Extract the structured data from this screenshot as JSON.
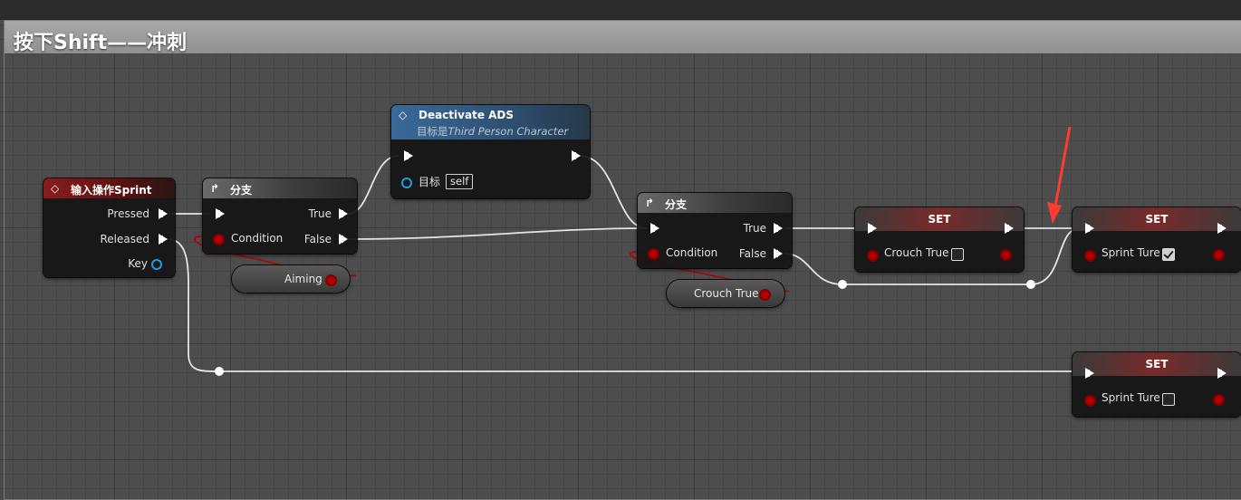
{
  "comment": {
    "title": "按下Shift——冲刺"
  },
  "nodes": {
    "input_action": {
      "title": "输入操作Sprint",
      "pins": {
        "pressed": "Pressed",
        "released": "Released",
        "key": "Key"
      }
    },
    "branch1": {
      "title": "分支",
      "pins": {
        "condition": "Condition",
        "true": "True",
        "false": "False"
      }
    },
    "aiming_var": {
      "label": "Aiming"
    },
    "deactivate_ads": {
      "title": "Deactivate ADS",
      "subtitle_prefix": "目标是",
      "subtitle_target": "Third Person Character",
      "pins": {
        "target": "目标",
        "target_value": "self"
      }
    },
    "branch2": {
      "title": "分支",
      "pins": {
        "condition": "Condition",
        "true": "True",
        "false": "False"
      }
    },
    "crouch_var": {
      "label": "Crouch True"
    },
    "set_crouch": {
      "title": "SET",
      "pin": "Crouch True",
      "checked": false
    },
    "set_sprint_true": {
      "title": "SET",
      "pin": "Sprint Ture",
      "checked": true
    },
    "set_sprint_false": {
      "title": "SET",
      "pin": "Sprint Ture",
      "checked": false
    }
  },
  "icons": {
    "event": "diamond-event-icon",
    "branch": "branch-icon",
    "function": "function-icon"
  },
  "colors": {
    "event_header": "#8a1c1c",
    "function_header": "#3a6a9a",
    "bool_pin": "#b00000",
    "key_pin": "#1e9be8",
    "annotation_arrow": "#ff3b30"
  }
}
